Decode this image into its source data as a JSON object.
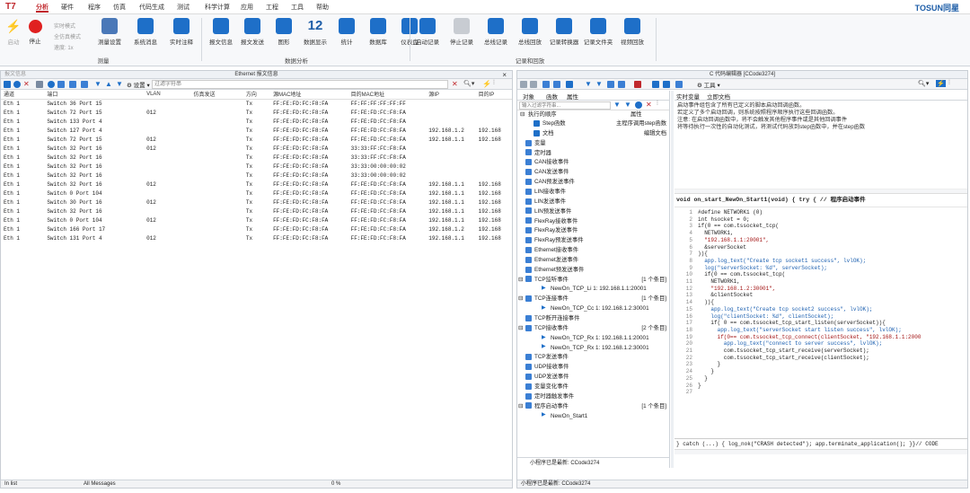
{
  "menu": {
    "app_logo": "T7",
    "items": [
      "分析",
      "硬件",
      "程序",
      "仿真",
      "代码生成",
      "测试",
      "科学计算",
      "应用",
      "工程",
      "工具",
      "帮助"
    ],
    "active_index": 0,
    "brand": "TOSUN同星"
  },
  "ribbon": {
    "left_small": {
      "start": "启动",
      "stop": "停止",
      "realtime": "实时模式",
      "fullspeed": "全仿真模式",
      "speed": "速度: 1x"
    },
    "group1_buttons": [
      "测量设置",
      "系统消息",
      "实时注释"
    ],
    "group1_label": "测量",
    "group2_buttons": [
      "报文信息",
      "报文发送",
      "图形",
      "数据显示",
      "统计",
      "数据库",
      "仪表盘"
    ],
    "group2_label": "数据分析",
    "group3_buttons": [
      "启动记录",
      "停止记录",
      "总线记录",
      "总线回放",
      "记录转换器",
      "记录文件夹",
      "视频回放"
    ],
    "group3_label": "记录和回放",
    "counter_icon": "12"
  },
  "left_panel": {
    "window_title": "报文信息",
    "header": "Ethernet 报文信息",
    "settings_label": "设置",
    "filter_placeholder": "过滤字符串",
    "columns": [
      "通道",
      "端口",
      "VLAN",
      "仿真发送",
      "方向",
      "源MAC地址",
      "目的MAC地址",
      "源IP",
      "目的IP"
    ],
    "rows": [
      [
        "Eth 1",
        "Switch 36 Port 15",
        "",
        "",
        "Tx",
        "FF:FE:FD:FC:F8:FA",
        "FF:FF:FF:FF:FF:FF",
        "",
        ""
      ],
      [
        "Eth 1",
        "Switch 72 Port 15",
        "012",
        "",
        "Tx",
        "FF:FE:FD:FC:F8:FA",
        "FF:FE:FD:FC:F8:FA",
        "",
        ""
      ],
      [
        "Eth 1",
        "Switch 133 Port 4",
        "",
        "",
        "Tx",
        "FF:FE:FD:FC:F8:FA",
        "FF:FE:FD:FC:F8:FA",
        "",
        ""
      ],
      [
        "Eth 1",
        "Switch 127 Port 4",
        "",
        "",
        "Tx",
        "FF:FE:FD:FC:F8:FA",
        "FF:FE:FD:FC:F8:FA",
        "192.168.1.2",
        "192.168"
      ],
      [
        "Eth 1",
        "Switch 72 Port 15",
        "012",
        "",
        "Tx",
        "FF:FE:FD:FC:F8:FA",
        "FF:FE:FD:FC:F8:FA",
        "192.168.1.1",
        "192.168"
      ],
      [
        "Eth 1",
        "Switch 32 Port 16",
        "012",
        "",
        "Tx",
        "FF:FE:FD:FC:F8:FA",
        "33:33:FF:FC:F8:FA",
        "",
        ""
      ],
      [
        "Eth 1",
        "Switch 32 Port 16",
        "",
        "",
        "Tx",
        "FF:FE:FD:FC:F8:FA",
        "33:33:FF:FC:F8:FA",
        "",
        ""
      ],
      [
        "Eth 1",
        "Switch 32 Port 16",
        "",
        "",
        "Tx",
        "FF:FE:FD:FC:F8:FA",
        "33:33:00:00:00:02",
        "",
        ""
      ],
      [
        "Eth 1",
        "Switch 32 Port 16",
        "",
        "",
        "Tx",
        "FF:FE:FD:FC:F8:FA",
        "33:33:00:00:00:02",
        "",
        ""
      ],
      [
        "Eth 1",
        "Switch 32 Port 16",
        "012",
        "",
        "Tx",
        "FF:FE:FD:FC:F8:FA",
        "FF:FE:FD:FC:F8:FA",
        "192.168.1.1",
        "192.168"
      ],
      [
        "Eth 1",
        "Switch 0 Port 104",
        "",
        "",
        "Tx",
        "FF:FE:FD:FC:F8:FA",
        "FF:FE:FD:FC:F8:FA",
        "192.168.1.1",
        "192.168"
      ],
      [
        "Eth 1",
        "Switch 30 Port 16",
        "012",
        "",
        "Tx",
        "FF:FE:FD:FC:F8:FA",
        "FF:FE:FD:FC:F8:FA",
        "192.168.1.1",
        "192.168"
      ],
      [
        "Eth 1",
        "Switch 32 Port 16",
        "",
        "",
        "Tx",
        "FF:FE:FD:FC:F8:FA",
        "FF:FE:FD:FC:F8:FA",
        "192.168.1.1",
        "192.168"
      ],
      [
        "Eth 1",
        "Switch 0 Port 104",
        "012",
        "",
        "Tx",
        "FF:FE:FD:FC:F8:FA",
        "FF:FE:FD:FC:F8:FA",
        "192.168.1.1",
        "192.168"
      ],
      [
        "Eth 1",
        "Switch 166 Port 17",
        "",
        "",
        "Tx",
        "FF:FE:FD:FC:F8:FA",
        "FF:FE:FD:FC:F8:FA",
        "192.168.1.2",
        "192.168"
      ],
      [
        "Eth 1",
        "Switch 131 Port 4",
        "012",
        "",
        "Tx",
        "FF:FE:FD:FC:F8:FA",
        "FF:FE:FD:FC:F8:FA",
        "192.168.1.1",
        "192.168"
      ]
    ],
    "status": {
      "left": "In list",
      "mid": "All Messages",
      "pct": "0 %"
    }
  },
  "right_panel": {
    "window_title": "C 代码编辑器 [CCode3274]",
    "tabs": [
      "对象",
      "函数",
      "属性"
    ],
    "tool_label": "工具",
    "filter_placeholder": "输入过滤字符串...",
    "tree_header": {
      "name": "执行的顺序",
      "value": "属性"
    },
    "tree": [
      {
        "label": "Step函数",
        "value": "主程序调用step函数",
        "indent": 2
      },
      {
        "label": "文档",
        "value": "编辑文档",
        "indent": 2
      },
      {
        "label": "变量",
        "value": "",
        "indent": 1
      },
      {
        "label": "定时器",
        "value": "",
        "indent": 1
      },
      {
        "label": "CAN接收事件",
        "value": "",
        "indent": 1
      },
      {
        "label": "CAN发送事件",
        "value": "",
        "indent": 1
      },
      {
        "label": "CAN预发送事件",
        "value": "",
        "indent": 1
      },
      {
        "label": "LIN接收事件",
        "value": "",
        "indent": 1
      },
      {
        "label": "LIN发送事件",
        "value": "",
        "indent": 1
      },
      {
        "label": "LIN预发送事件",
        "value": "",
        "indent": 1
      },
      {
        "label": "FlexRay接收事件",
        "value": "",
        "indent": 1
      },
      {
        "label": "FlexRay发送事件",
        "value": "",
        "indent": 1
      },
      {
        "label": "FlexRay预发送事件",
        "value": "",
        "indent": 1
      },
      {
        "label": "Ethernet接收事件",
        "value": "",
        "indent": 1
      },
      {
        "label": "Ethernet发送事件",
        "value": "",
        "indent": 1
      },
      {
        "label": "Ethernet预发送事件",
        "value": "",
        "indent": 1
      },
      {
        "label": "TCP监听事件",
        "value": "[1 个条目]",
        "indent": 1
      },
      {
        "label": "NewOn_TCP_Li 1: 192.168.1.1:20001",
        "value": "",
        "indent": 3
      },
      {
        "label": "TCP连接事件",
        "value": "[1 个条目]",
        "indent": 1
      },
      {
        "label": "NewOn_TCP_Cc 1: 192.168.1.2:30001",
        "value": "",
        "indent": 3
      },
      {
        "label": "TCP断开连接事件",
        "value": "",
        "indent": 1
      },
      {
        "label": "TCP接收事件",
        "value": "[2 个条目]",
        "indent": 1
      },
      {
        "label": "NewOn_TCP_Rx 1: 192.168.1.1:20001",
        "value": "",
        "indent": 3
      },
      {
        "label": "NewOn_TCP_Rx 1: 192.168.1.2:30001",
        "value": "",
        "indent": 3
      },
      {
        "label": "TCP发送事件",
        "value": "",
        "indent": 1
      },
      {
        "label": "UDP接收事件",
        "value": "",
        "indent": 1
      },
      {
        "label": "UDP发送事件",
        "value": "",
        "indent": 1
      },
      {
        "label": "变量变化事件",
        "value": "",
        "indent": 1
      },
      {
        "label": "定时器触发事件",
        "value": "",
        "indent": 1
      },
      {
        "label": "程序启动事件",
        "value": "[1 个条目]",
        "indent": 1
      },
      {
        "label": "NewOn_Start1",
        "value": "",
        "indent": 3
      }
    ],
    "tree_status": "小程序已是最新: CCode3274",
    "doc_tabs": [
      "实时变量",
      "立即文档"
    ],
    "doc_lines": [
      "启动事件组包含了所有已定义的脚本启动回调函数。",
      "若定义了多个启动回调，则系统按照程序顺序执行这些回调函数。",
      "注意: 在启动回调函数中，将不会触发其他程序事件或是其他回调事件",
      "      将等待执行一次性的自动化测试，将测试代码放到step函数中，并在step函数"
    ],
    "func_sig": "void on_start_NewOn_Start1(void) { try { // 程序启动事件",
    "line_numbers": [
      "1",
      "2",
      "3",
      "4",
      "5",
      "6",
      "7",
      "8",
      "9",
      "10",
      "11",
      "12",
      "13",
      "14",
      "15",
      "16",
      "17",
      "18",
      "19",
      "20",
      "21",
      "22",
      "23",
      "24",
      "25",
      "26",
      "27"
    ],
    "code_lines": [
      "#define NETWORK1 (0)",
      "int hsocket = 0;",
      "if(0 == com.tssocket_tcp(",
      "  NETWORK1,",
      "  \"192.168.1.1:20001\",",
      "  &serverSocket",
      ")){",
      "  app.log_text(\"Create tcp socket1 success\", lvlOK);",
      "  log(\"serverSocket: %d\", serverSocket);",
      "  if(0 == com.tssocket_tcp(",
      "    NETWORK1,",
      "    \"192.168.1.2:30001\",",
      "    &clientSocket",
      "  )){",
      "    app.log_text(\"Create tcp socket2 success\", lvlOK);",
      "    log(\"clientSocket: %d\", clientSocket);",
      "    if( 0 == com.tssocket_tcp_start_listen(serverSocket)){",
      "      app.log_text(\"serverSocket start listen success\", lvlOK);",
      "      if(0== com.tssocket_tcp_connect(clientSocket, \"192.168.1.1:2000",
      "        app.log_text(\"connect to server success\", lvlOK);",
      "        com.tssocket_tcp_start_receive(serverSocket);",
      "        com.tssocket_tcp_start_receive(clientSocket);",
      "      }",
      "    }",
      "  }",
      "}",
      ""
    ],
    "catch_line": "} catch (...) { log_nok(\"CRASH detected\"); app.terminate_application(); }}// CODE",
    "status": "小程序已是最新: CCode3274"
  },
  "colors": {
    "accent": "#c0282d",
    "blue_icon": "#1e6fc8",
    "brand": "#1e5ea8"
  }
}
